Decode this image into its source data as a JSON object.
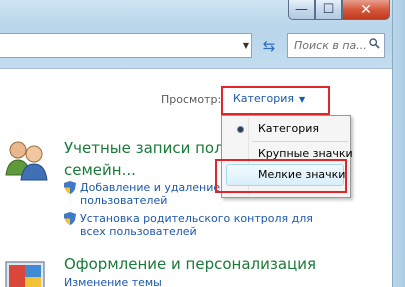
{
  "window": {
    "minimize_glyph": "—",
    "maximize_glyph": "☐",
    "close_glyph": "✕"
  },
  "toolbar": {
    "search_placeholder": "Поиск в па...",
    "refresh_glyph": "⇆",
    "dropdown_glyph": "▼"
  },
  "view": {
    "label": "Просмотр:",
    "value": "Категория",
    "arrow": "▼"
  },
  "categories": [
    {
      "title_line1": "Учетные записи польз",
      "title_line2": "семейн...",
      "icon": "users-icon",
      "links": [
        {
          "line1": "Добавление и удаление",
          "line2": "пользователей",
          "icon": "shield-icon"
        },
        {
          "line1": "Установка родительского контроля для",
          "line2": "всех пользователей",
          "icon": "shield-icon"
        }
      ]
    },
    {
      "title_line1": "Оформление и персонализация",
      "icon": "display-icon",
      "links": [
        {
          "line1": "Изменение темы"
        }
      ]
    }
  ],
  "menu": {
    "items": [
      {
        "label": "Категория",
        "selected": true
      },
      {
        "label": "Крупные значки",
        "selected": false
      },
      {
        "label": "Мелкие значки",
        "selected": false,
        "hovered": true
      }
    ]
  },
  "colors": {
    "highlight_red": "#e0262b",
    "link_blue": "#1c59a8",
    "title_green": "#1a7a38"
  }
}
